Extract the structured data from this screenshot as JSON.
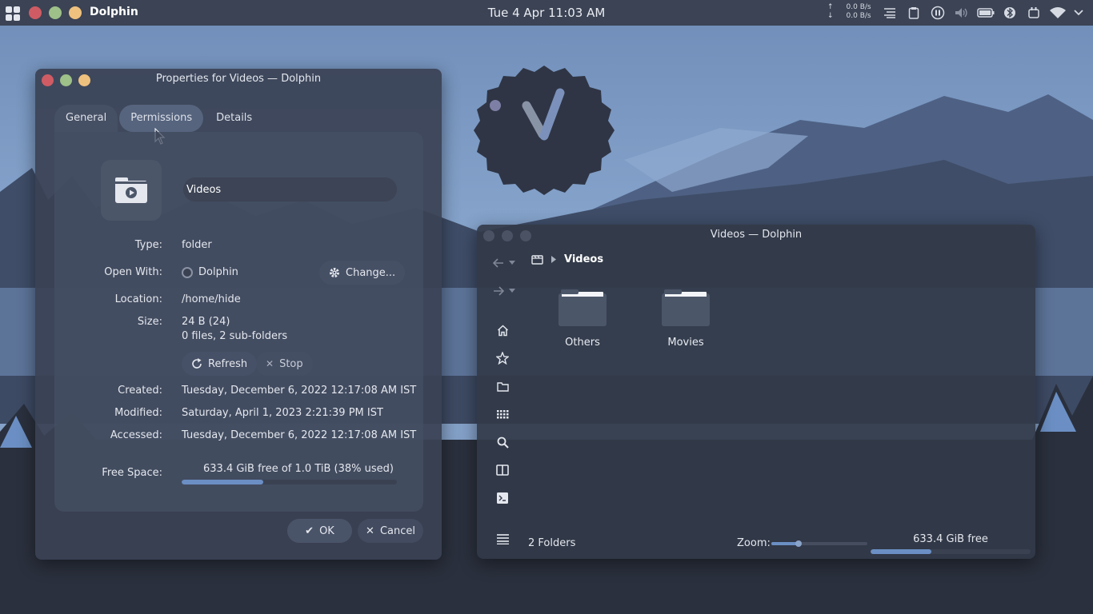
{
  "topbar": {
    "app_name": "Dolphin",
    "clock": "Tue 4 Apr 11:03 AM",
    "net_up": "0.0 B/s",
    "net_down": "0.0 B/s",
    "net_up_arrow": "↑",
    "net_down_arrow": "↓",
    "tray_icons": [
      "list-icon",
      "clipboard-icon",
      "pause-icon",
      "volume-icon",
      "battery-icon",
      "bluetooth-icon",
      "plug-icon",
      "wifi-icon"
    ]
  },
  "properties_window": {
    "title": "Properties for Videos — Dolphin",
    "tabs": [
      {
        "label": "General"
      },
      {
        "label": "Permissions"
      },
      {
        "label": "Details"
      }
    ],
    "name_value": "Videos",
    "type_label": "Type:",
    "type_value": "folder",
    "open_with_label": "Open With:",
    "open_with_value": "Dolphin",
    "change_button": "Change...",
    "location_label": "Location:",
    "location_value": "/home/hide",
    "size_label": "Size:",
    "size_value": "24 B (24)",
    "size_detail": "0 files, 2 sub-folders",
    "refresh_button": "Refresh",
    "stop_button": "Stop",
    "created_label": "Created:",
    "created_value": "Tuesday, December 6, 2022 12:17:08 AM IST",
    "modified_label": "Modified:",
    "modified_value": "Saturday, April 1, 2023 2:21:39 PM IST",
    "accessed_label": "Accessed:",
    "accessed_value": "Tuesday, December 6, 2022 12:17:08 AM IST",
    "free_space_label": "Free Space:",
    "free_space_value": "633.4 GiB free of 1.0 TiB (38% used)",
    "free_space_used_fraction": 0.38,
    "ok_button": "OK",
    "cancel_button": "Cancel"
  },
  "dolphin_window": {
    "title": "Videos — Dolphin",
    "breadcrumb": "Videos",
    "folders": [
      {
        "label": "Others"
      },
      {
        "label": "Movies"
      }
    ],
    "status_count": "2 Folders",
    "zoom_label": "Zoom:",
    "zoom_fraction": 0.28,
    "free_space": "633.4 GiB free",
    "free_fraction": 0.38
  },
  "colors": {
    "accent": "#6b8fc4",
    "close": "#cf5c64",
    "minimize": "#9ec089",
    "maximize": "#efc17e",
    "panel": "#3b4354"
  }
}
